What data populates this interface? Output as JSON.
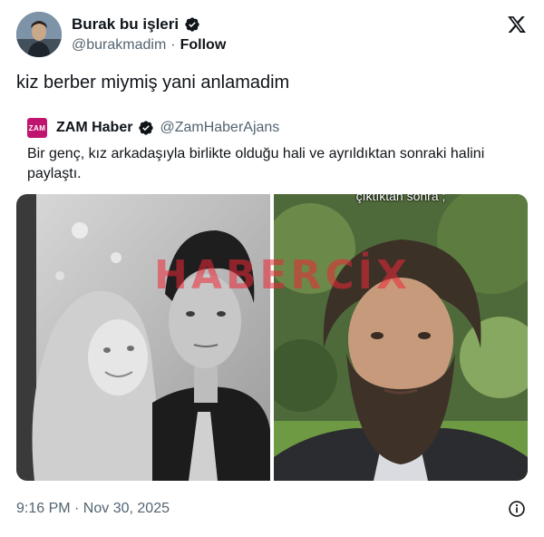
{
  "author": {
    "name": "Burak bu işleri",
    "handle": "@burakmadim",
    "separator": "·",
    "follow_label": "Follow",
    "verified": true,
    "avatar_icon": "profile-photo"
  },
  "tweet": {
    "text": "kiz berber miymiş yani anlamadim"
  },
  "quote": {
    "avatar_label": "ZAM",
    "name": "ZAM Haber",
    "handle": "@ZamHaberAjans",
    "verified": true,
    "text": "Bir genç, kız arkadaşıyla birlikte olduğu hali ve ayrıldıktan sonraki halini paylaştı.",
    "media": {
      "right_caption": "çıktıktan sonra ;"
    }
  },
  "watermark": "HABERCİX",
  "footer": {
    "timestamp": "9:16 PM · Nov 30, 2025",
    "info_icon": "info-icon"
  },
  "colors": {
    "text_primary": "#0f1419",
    "text_secondary": "#536471",
    "verified_badge": "#0f1419",
    "zam_brand": "#c0156e",
    "watermark": "#eb2837"
  }
}
